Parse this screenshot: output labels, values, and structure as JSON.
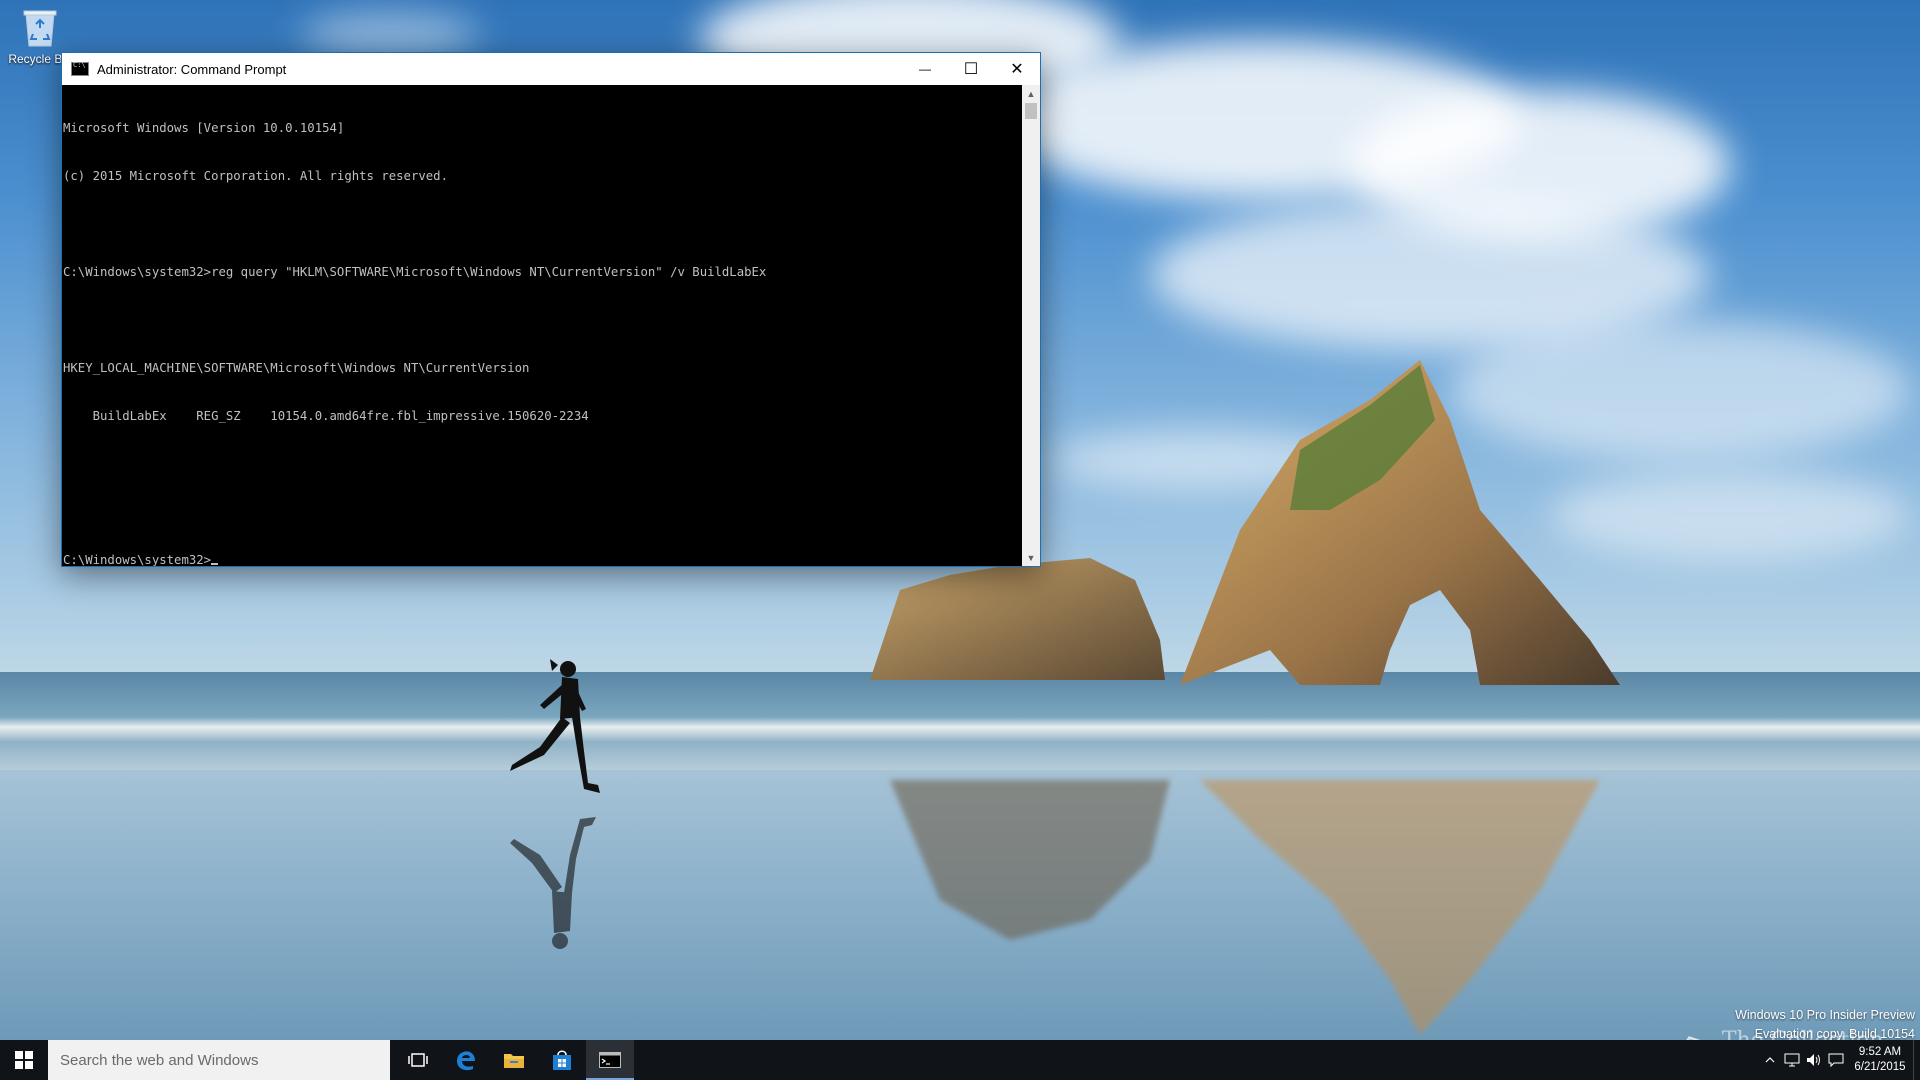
{
  "desktop": {
    "icons": [
      {
        "label": "Recycle Bin",
        "icon": "recycle-bin-icon"
      }
    ]
  },
  "cmd_window": {
    "title": "Administrator: Command Prompt",
    "controls": {
      "minimize": "—",
      "maximize": "☐",
      "close": "✕"
    },
    "lines": [
      "Microsoft Windows [Version 10.0.10154]",
      "(c) 2015 Microsoft Corporation. All rights reserved.",
      "",
      "C:\\Windows\\system32>reg query \"HKLM\\SOFTWARE\\Microsoft\\Windows NT\\CurrentVersion\" /v BuildLabEx",
      "",
      "HKEY_LOCAL_MACHINE\\SOFTWARE\\Microsoft\\Windows NT\\CurrentVersion",
      "    BuildLabEx    REG_SZ    10154.0.amd64fre.fbl_impressive.150620-2234",
      "",
      ""
    ],
    "prompt": "C:\\Windows\\system32>",
    "colors": {
      "background": "#000000",
      "text": "#c0c0c0",
      "border": "#1b6fb3"
    }
  },
  "watermark": {
    "line1": "Windows 10 Pro Insider Preview",
    "line2": "Evaluation copy. Build 10154"
  },
  "brand": {
    "text": "The Collection Book"
  },
  "taskbar": {
    "search_placeholder": "Search the web and Windows",
    "pinned": [
      {
        "name": "task-view-icon",
        "active": false
      },
      {
        "name": "edge-icon",
        "active": false
      },
      {
        "name": "file-explorer-icon",
        "active": false
      },
      {
        "name": "store-icon",
        "active": false
      },
      {
        "name": "command-prompt-icon",
        "active": true
      }
    ],
    "tray_icons": [
      "chevron-up-icon",
      "network-icon",
      "volume-icon",
      "action-center-icon"
    ],
    "clock": {
      "time": "9:52 AM",
      "date": "6/21/2015"
    },
    "colors": {
      "background": "#101418",
      "accent": "#7aa4d8"
    }
  }
}
